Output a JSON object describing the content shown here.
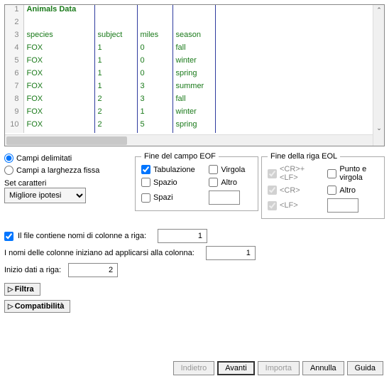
{
  "preview": {
    "rows": [
      {
        "n": "1",
        "c1": "Animals Data",
        "c2": "",
        "c3": "",
        "c4": "",
        "bold": true
      },
      {
        "n": "2",
        "c1": "",
        "c2": "",
        "c3": "",
        "c4": ""
      },
      {
        "n": "3",
        "c1": "species",
        "c2": "subject",
        "c3": "miles",
        "c4": "season"
      },
      {
        "n": "4",
        "c1": "FOX",
        "c2": "1",
        "c3": "0",
        "c4": "fall"
      },
      {
        "n": "5",
        "c1": "FOX",
        "c2": "1",
        "c3": "0",
        "c4": "winter"
      },
      {
        "n": "6",
        "c1": "FOX",
        "c2": "1",
        "c3": "0",
        "c4": "spring"
      },
      {
        "n": "7",
        "c1": "FOX",
        "c2": "1",
        "c3": "3",
        "c4": "summer"
      },
      {
        "n": "8",
        "c1": "FOX",
        "c2": "2",
        "c3": "3",
        "c4": "fall"
      },
      {
        "n": "9",
        "c1": "FOX",
        "c2": "2",
        "c3": "1",
        "c4": "winter"
      },
      {
        "n": "10",
        "c1": "FOX",
        "c2": "2",
        "c3": "5",
        "c4": "spring"
      }
    ]
  },
  "options": {
    "delimited": "Campi delimitati",
    "fixedwidth": "Campi a larghezza fissa",
    "charset_label": "Set caratteri",
    "charset_value": "Migliore ipotesi"
  },
  "eof": {
    "legend": "Fine del campo EOF",
    "tab": "Tabulazione",
    "space": "Spazio",
    "spaces": "Spazi",
    "comma": "Virgola",
    "other": "Altro",
    "other_value": ""
  },
  "eol": {
    "legend": "Fine della riga EOL",
    "crlf": "<CR>+<LF>",
    "cr": "<CR>",
    "lf": "<LF>",
    "semicolon": "Punto e virgola",
    "other": "Altro",
    "other_value": ""
  },
  "colnames": {
    "has_names": "Il file contiene nomi di colonne a riga:",
    "names_row": "1",
    "apply_label": "I nomi delle colonne iniziano ad applicarsi alla colonna:",
    "apply_col": "1",
    "data_start_label": "Inizio dati a riga:",
    "data_start": "2"
  },
  "expanders": {
    "filter": "Filtra",
    "compat": "Compatibilità"
  },
  "footer": {
    "back": "Indietro",
    "next": "Avanti",
    "import": "Importa",
    "cancel": "Annulla",
    "help": "Guida"
  }
}
